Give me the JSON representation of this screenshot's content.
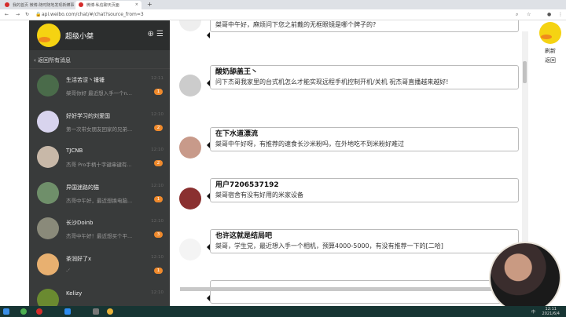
{
  "browser": {
    "tabs": [
      {
        "label": "我的首页 微博-随时随地发现新鲜事"
      },
      {
        "label": "微博-私信聊天页面"
      }
    ],
    "new_tab": "+",
    "url": "api.weibo.com/chat/#/chat?source_from=3"
  },
  "sidebar": {
    "title": "超级小桀",
    "back": "返回所有消息",
    "items": [
      {
        "name": "生活苦涩丶锤锤",
        "preview": "桀哥你好  最近想入手一个n...",
        "time": "12:11",
        "badge": "1",
        "color": "#4a6b4a"
      },
      {
        "name": "好好学习的刘爱国",
        "preview": "第一次带女朋友回家的兄弟...",
        "time": "12:10",
        "badge": "2",
        "color": "#d8d4ee"
      },
      {
        "name": "TJCNB",
        "preview": "杰哥 Pro手柄十字键串键有...",
        "time": "12:10",
        "badge": "2",
        "color": "#c8b8a8"
      },
      {
        "name": "异国迷路的猫",
        "preview": "杰哥中午好，最近想换电脑...",
        "time": "12:10",
        "badge": "1",
        "color": "#6f8f6a"
      },
      {
        "name": "长沙Doinb",
        "preview": "杰哥中午好！最近想买个平...",
        "time": "12:10",
        "badge": "3",
        "color": "#8a8a7a"
      },
      {
        "name": "茶润好了x",
        "preview": "-ᐟ",
        "time": "12:10",
        "badge": "1",
        "color": "#e8b070"
      },
      {
        "name": "Kelizy",
        "preview": "",
        "time": "12:10",
        "badge": "",
        "color": "#6a8a30"
      }
    ]
  },
  "messages": [
    {
      "name": "",
      "text": "桀哥中午好，麻烦问下您之前戴的无框眼镜是哪个牌子的?",
      "color": "#eee"
    },
    {
      "name": "酸奶舔盖王丶",
      "text": "问下杰哥我家里的台式机怎么才能实现远程手机控制开机/关机  祝杰哥直播越来越好!",
      "color": "#ccc"
    },
    {
      "name": "在下水道漂流",
      "text": "桀哥中午好呀，有推荐的速食长沙米粉吗，在外地吃不到米粉好难过",
      "color": "#c89a8a"
    },
    {
      "name": "用户7206537192",
      "text": "桀哥宿舍有没有好用的米家设备",
      "color": "#8a3030"
    },
    {
      "name": "也许这就是结局吧",
      "text": "桀哥，学生党，最近想入手一个相机，预算4000-5000，有没有推荐一下的[二哈]",
      "color": "#f4f4f4"
    }
  ],
  "right": {
    "refresh": "刷新",
    "back": "返回"
  },
  "taskbar": {
    "time": "12:11",
    "date": "2021/6/4",
    "ime": "中"
  },
  "colors": {
    "accent": "#f08a2c",
    "sidebar": "#393b3b"
  }
}
